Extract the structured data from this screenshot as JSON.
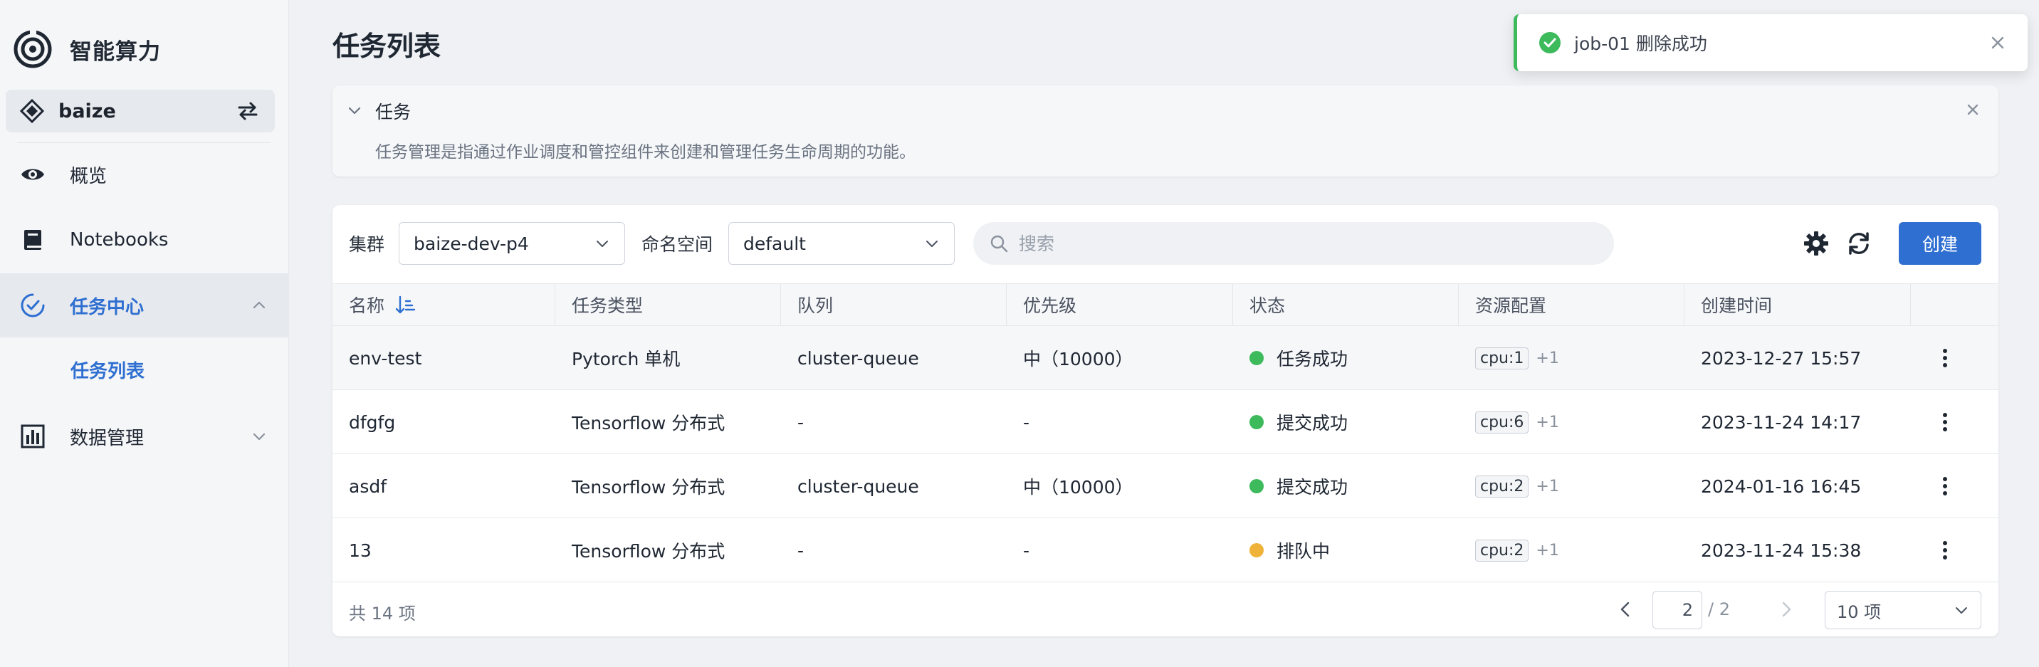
{
  "app": {
    "title": "智能算力"
  },
  "workspace": {
    "name": "baize"
  },
  "sidebar": {
    "items": [
      {
        "label": "概览"
      },
      {
        "label": "Notebooks"
      },
      {
        "label": "任务中心"
      },
      {
        "label": "数据管理"
      }
    ],
    "sub_item": {
      "label": "任务列表"
    }
  },
  "page": {
    "title": "任务列表"
  },
  "info": {
    "title": "任务",
    "description": "任务管理是指通过作业调度和管控组件来创建和管理任务生命周期的功能。"
  },
  "toolbar": {
    "cluster_label": "集群",
    "cluster_value": "baize-dev-p4",
    "namespace_label": "命名空间",
    "namespace_value": "default",
    "search_placeholder": "搜索",
    "create_label": "创建"
  },
  "table": {
    "columns": [
      "名称",
      "任务类型",
      "队列",
      "优先级",
      "状态",
      "资源配置",
      "创建时间"
    ],
    "rows": [
      {
        "name": "env-test",
        "type": "Pytorch 单机",
        "queue": "cluster-queue",
        "priority": "中（10000）",
        "status": "任务成功",
        "status_color": "#3dba5c",
        "resource": "cpu:1",
        "resource_more": "+1",
        "created": "2023-12-27 15:57"
      },
      {
        "name": "dfgfg",
        "type": "Tensorflow 分布式",
        "queue": "-",
        "priority": "-",
        "status": "提交成功",
        "status_color": "#3dba5c",
        "resource": "cpu:6",
        "resource_more": "+1",
        "created": "2023-11-24 14:17"
      },
      {
        "name": "asdf",
        "type": "Tensorflow 分布式",
        "queue": "cluster-queue",
        "priority": "中（10000）",
        "status": "提交成功",
        "status_color": "#3dba5c",
        "resource": "cpu:2",
        "resource_more": "+1",
        "created": "2024-01-16 16:45"
      },
      {
        "name": "13",
        "type": "Tensorflow 分布式",
        "queue": "-",
        "priority": "-",
        "status": "排队中",
        "status_color": "#f0b33a",
        "resource": "cpu:2",
        "resource_more": "+1",
        "created": "2023-11-24 15:38"
      }
    ]
  },
  "pagination": {
    "total": "共 14 项",
    "current_page": "2",
    "total_pages": "/ 2",
    "page_size": "10 项"
  },
  "toast": {
    "message": "job-01 删除成功"
  },
  "colors": {
    "accent": "#2e6fd1",
    "success": "#3dba5c",
    "warning": "#f0b33a"
  }
}
